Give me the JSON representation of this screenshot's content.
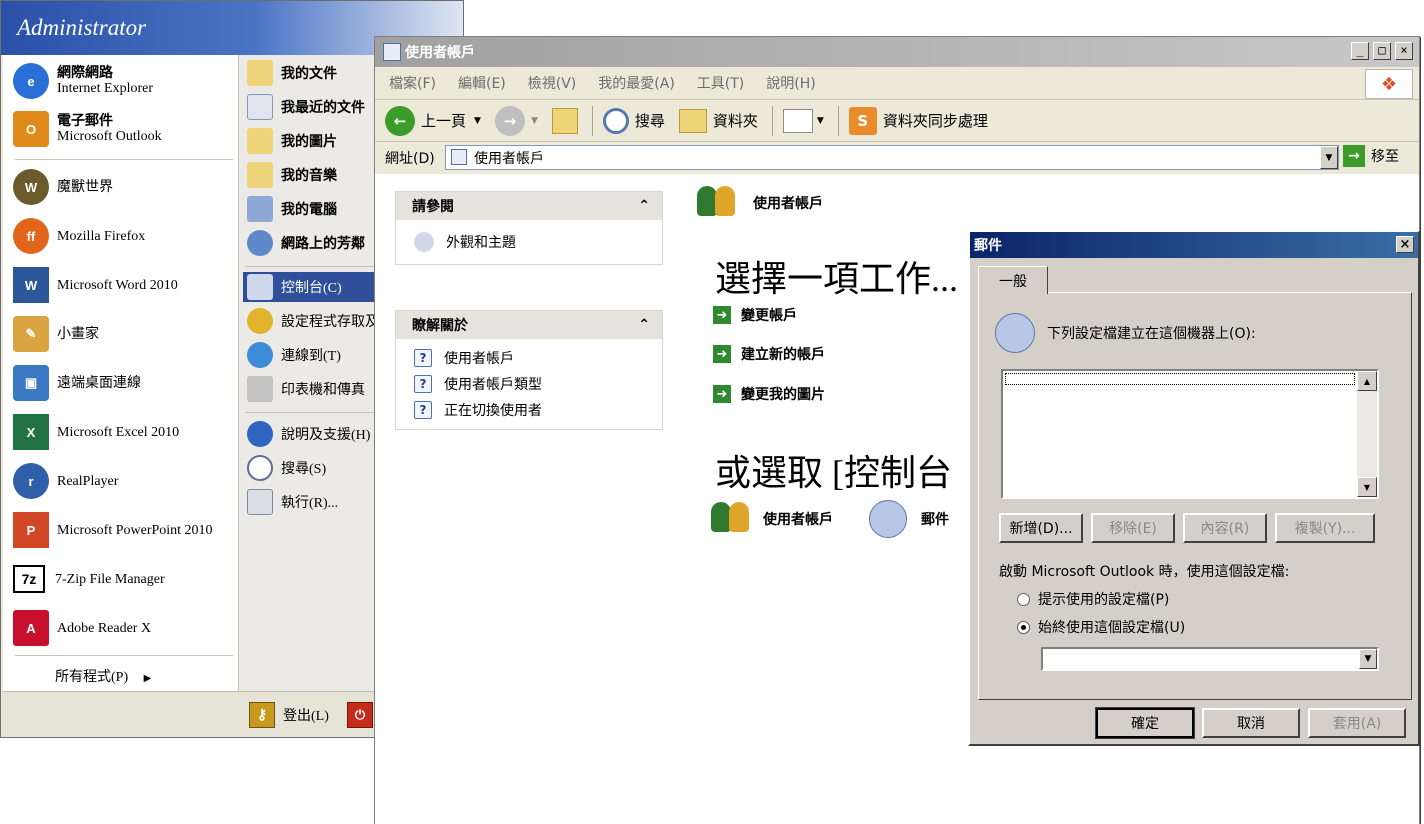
{
  "start_menu": {
    "user": "Administrator",
    "left_items": [
      {
        "title": "網際網路",
        "subtitle": "Internet Explorer",
        "icon": "internet-explorer-icon",
        "color": "#2a6fd6"
      },
      {
        "title": "電子郵件",
        "subtitle": "Microsoft Outlook",
        "icon": "outlook-icon",
        "color": "#e08a1a"
      },
      {
        "title": "魔獸世界",
        "subtitle": "",
        "icon": "world-of-warcraft-icon",
        "color": "#6b5a2c"
      },
      {
        "title": "Mozilla Firefox",
        "subtitle": "",
        "icon": "firefox-icon",
        "color": "#e2651c"
      },
      {
        "title": "Microsoft Word 2010",
        "subtitle": "",
        "icon": "word-icon",
        "color": "#2b579a"
      },
      {
        "title": "小畫家",
        "subtitle": "",
        "icon": "paint-icon",
        "color": "#d9a441"
      },
      {
        "title": "遠端桌面連線",
        "subtitle": "",
        "icon": "remote-desktop-icon",
        "color": "#3c79c5"
      },
      {
        "title": "Microsoft Excel 2010",
        "subtitle": "",
        "icon": "excel-icon",
        "color": "#217346"
      },
      {
        "title": "RealPlayer",
        "subtitle": "",
        "icon": "realplayer-icon",
        "color": "#2f5fa8"
      },
      {
        "title": "Microsoft PowerPoint 2010",
        "subtitle": "",
        "icon": "powerpoint-icon",
        "color": "#d24726"
      },
      {
        "title": "7-Zip File Manager",
        "subtitle": "",
        "icon": "7zip-icon",
        "color": "#000000"
      },
      {
        "title": "Adobe Reader X",
        "subtitle": "",
        "icon": "adobe-reader-icon",
        "color": "#c8102e"
      }
    ],
    "all_programs": "所有程式(P)",
    "right_items": [
      {
        "label": "我的文件",
        "icon": "my-documents-icon",
        "bold": true
      },
      {
        "label": "我最近的文件",
        "icon": "recent-documents-icon",
        "bold": true
      },
      {
        "label": "我的圖片",
        "icon": "my-pictures-icon",
        "bold": true
      },
      {
        "label": "我的音樂",
        "icon": "my-music-icon",
        "bold": true
      },
      {
        "label": "我的電腦",
        "icon": "my-computer-icon",
        "bold": true
      },
      {
        "label": "網路上的芳鄰",
        "icon": "network-places-icon",
        "bold": true
      },
      {
        "label": "控制台(C)",
        "icon": "control-panel-icon",
        "bold": false
      },
      {
        "label": "設定程式存取及",
        "icon": "program-access-icon",
        "bold": false
      },
      {
        "label": "連線到(T)",
        "icon": "connect-to-icon",
        "bold": false
      },
      {
        "label": "印表機和傳真",
        "icon": "printers-icon",
        "bold": false
      },
      {
        "label": "說明及支援(H)",
        "icon": "help-icon",
        "bold": false
      },
      {
        "label": "搜尋(S)",
        "icon": "search-icon",
        "bold": false
      },
      {
        "label": "執行(R)...",
        "icon": "run-icon",
        "bold": false
      }
    ],
    "logoff": "登出(L)"
  },
  "explorer": {
    "title": "使用者帳戶",
    "menu": [
      "檔案(F)",
      "編輯(E)",
      "檢視(V)",
      "我的最愛(A)",
      "工具(T)",
      "說明(H)"
    ],
    "toolbar": {
      "back": "上一頁",
      "search": "搜尋",
      "folders": "資料夾",
      "sync": "資料夾同步處理"
    },
    "address_label": "網址(D)",
    "address_value": "使用者帳戶",
    "go": "移至",
    "see_also": {
      "title": "請參閱",
      "items": [
        "外觀和主題"
      ]
    },
    "learn_about": {
      "title": "瞭解關於",
      "items": [
        "使用者帳戶",
        "使用者帳戶類型",
        "正在切換使用者"
      ]
    },
    "header_label": "使用者帳戶",
    "pick_task": "選擇一項工作...",
    "tasks": [
      "變更帳戶",
      "建立新的帳戶",
      "變更我的圖片"
    ],
    "or_pick": "或選取 [控制台",
    "icons": [
      "使用者帳戶",
      "郵件"
    ]
  },
  "mail_dialog": {
    "title": "郵件",
    "tab": "一般",
    "profiles_label": "下列設定檔建立在這個機器上(O):",
    "buttons": {
      "add": "新增(D)...",
      "remove": "移除(E)",
      "properties": "內容(R)",
      "copy": "複製(Y)..."
    },
    "startup_label": "啟動 Microsoft Outlook 時，使用這個設定檔:",
    "radio_prompt": "提示使用的設定檔(P)",
    "radio_always": "始終使用這個設定檔(U)",
    "ok": "確定",
    "cancel": "取消",
    "apply": "套用(A)"
  }
}
